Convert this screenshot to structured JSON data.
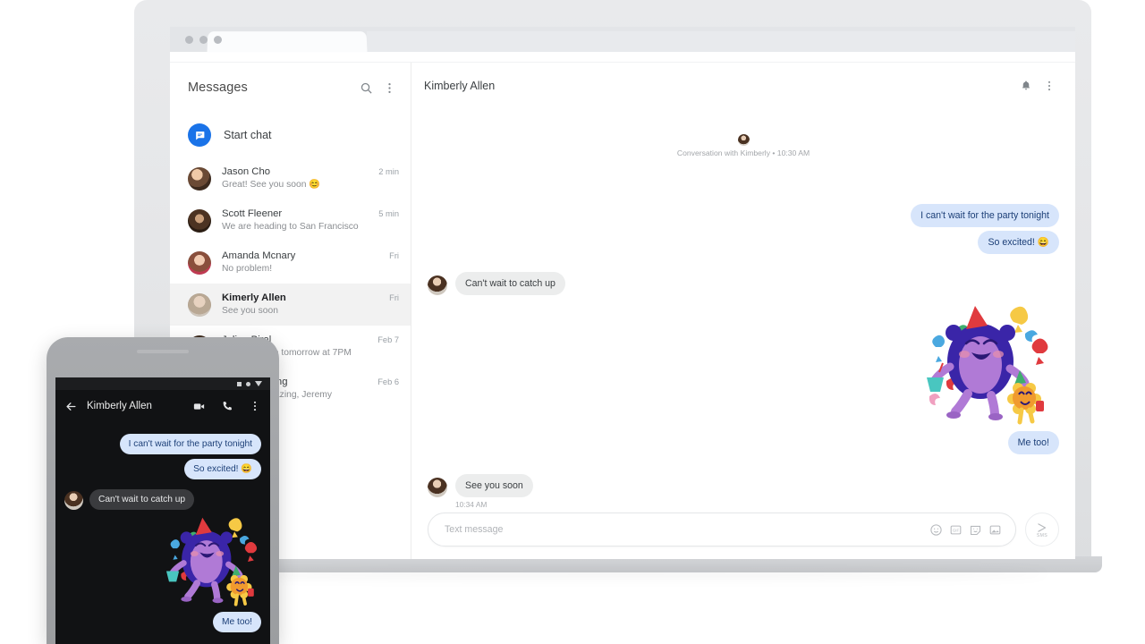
{
  "colors": {
    "accent": "#1a73e8",
    "sent_bubble": "#d7e5fb",
    "sent_text": "#1c3f77",
    "received_bubble": "#eceded",
    "selected_row": "#f2f2f2",
    "phone_dark_bg": "#111214",
    "phone_received_bubble": "#3a3b3e"
  },
  "sidebar": {
    "title": "Messages",
    "search_icon": "search-icon",
    "menu_icon": "more-vert-icon",
    "start_chat": {
      "label": "Start chat",
      "icon": "chat-bubble-icon"
    },
    "conversations": [
      {
        "name": "Jason Cho",
        "snippet": "Great! See you soon 😊",
        "time": "2 min",
        "selected": false
      },
      {
        "name": "Scott Fleener",
        "snippet": "We are heading to San Francisco",
        "time": "5 min",
        "selected": false
      },
      {
        "name": "Amanda Mcnary",
        "snippet": "No problem!",
        "time": "Fri",
        "selected": false
      },
      {
        "name": "Kimerly Allen",
        "snippet": "See you soon",
        "time": "Fri",
        "selected": true
      },
      {
        "name": "Julien Biral",
        "snippet": "I am available tomorrow at 7PM",
        "time": "Feb 7",
        "selected": false
      },
      {
        "name": "Party Planning",
        "snippet": "That was amazing, Jeremy",
        "time": "Feb 6",
        "selected": false
      }
    ]
  },
  "chat": {
    "title": "Kimberly Allen",
    "notifications_icon": "bell-icon",
    "menu_icon": "more-vert-icon",
    "conversation_start": "Conversation with Kimberly • 10:30 AM",
    "messages": [
      {
        "dir": "out",
        "text": "I can't wait for the party tonight"
      },
      {
        "dir": "out",
        "text": "So excited! 😄"
      },
      {
        "dir": "in",
        "text": "Can't wait to catch up"
      },
      {
        "dir": "out",
        "type": "sticker",
        "sticker": "party-monster-sticker"
      },
      {
        "dir": "out",
        "text": "Me too!"
      },
      {
        "dir": "in",
        "text": "See you soon",
        "time": "10:34 AM"
      }
    ],
    "composer": {
      "placeholder": "Text message",
      "value": "",
      "icons": [
        "emoji-icon",
        "gif-icon",
        "sticker-icon",
        "image-icon"
      ],
      "send_label": "SMS",
      "send_icon": "send-icon"
    }
  },
  "phone": {
    "back_icon": "arrow-back-icon",
    "title": "Kimberly Allen",
    "video_icon": "videocam-icon",
    "call_icon": "phone-icon",
    "menu_icon": "more-vert-icon",
    "status_icons": [
      "square-icon",
      "circle-icon",
      "triangle-icon"
    ],
    "messages": [
      {
        "dir": "out",
        "text": "I can't wait for the party tonight"
      },
      {
        "dir": "out",
        "text": "So excited! 😄"
      },
      {
        "dir": "in",
        "text": "Can't wait to catch up"
      },
      {
        "dir": "out",
        "type": "sticker",
        "sticker": "party-monster-sticker"
      },
      {
        "dir": "out",
        "text": "Me too!"
      }
    ]
  },
  "browser": {
    "traffic_lights": [
      "close-dot",
      "minimize-dot",
      "maximize-dot"
    ],
    "tab_label": ""
  }
}
